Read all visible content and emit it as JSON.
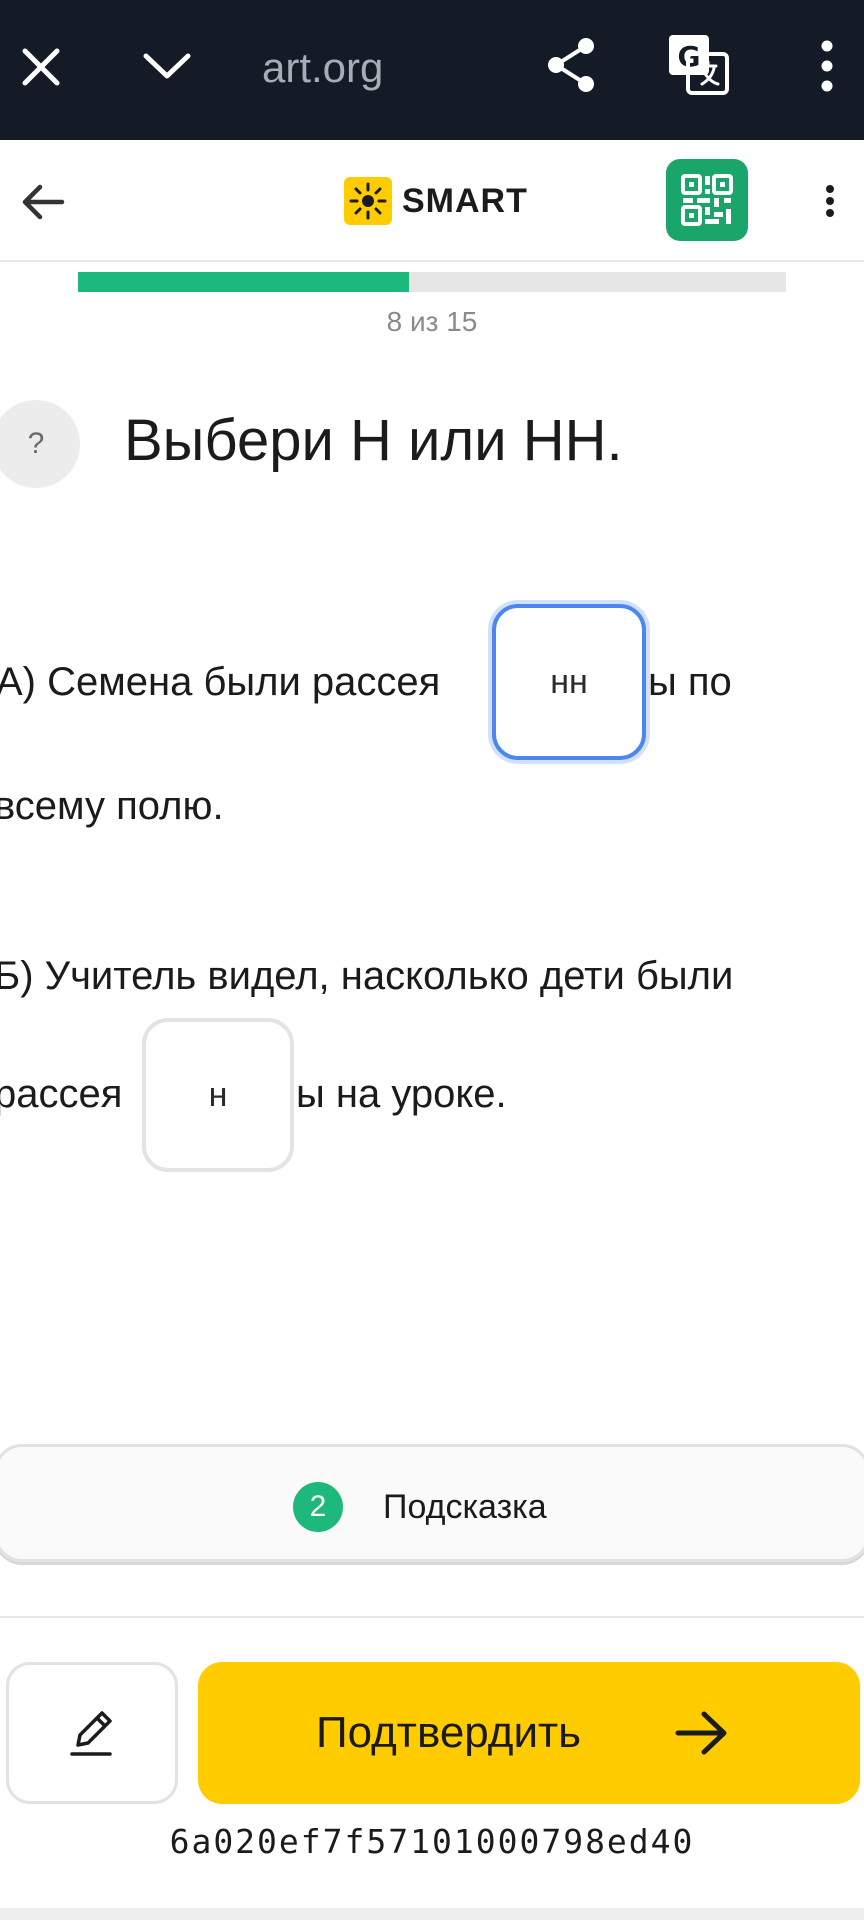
{
  "browser": {
    "url": "art.org",
    "icons": [
      "close-icon",
      "chevron-down-icon",
      "share-icon",
      "translate-icon",
      "more-vert-icon"
    ]
  },
  "header": {
    "logo_text": "SMART",
    "icons": [
      "arrow-left-icon",
      "sun-logo-icon",
      "qr-code-icon",
      "kebab-menu-icon"
    ],
    "colors": {
      "qr_button": "#1aa66a",
      "logo_mark": "#ffcc00"
    }
  },
  "progress": {
    "label": "8 из 15",
    "current": 8,
    "total": 15,
    "fill_fraction": 0.467,
    "color": "#1cb97a"
  },
  "question": {
    "help_symbol": "?",
    "title": "Выбери Н или НН.",
    "task_a": {
      "before": "А) Семена были рассея",
      "answer": "нн",
      "after": "ы по",
      "line2": "всему полю."
    },
    "task_b": {
      "line1": "Б) Учитель видел, насколько дети были",
      "before": "рассея",
      "answer": "н",
      "after": "ы на уроке."
    }
  },
  "hint": {
    "count": "2",
    "label": "Подсказка",
    "color": "#1cb97a"
  },
  "actions": {
    "confirm_label": "Подтвердить",
    "confirm_color": "#ffcc00",
    "pencil_icon": "pencil-icon",
    "arrow_icon": "arrow-right-icon"
  },
  "session_id": "6a020ef7f57101000798ed40"
}
